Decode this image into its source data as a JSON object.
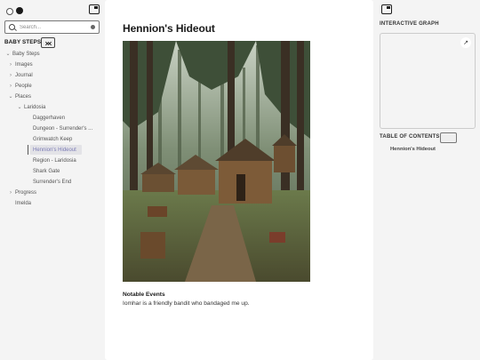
{
  "sidebar": {
    "search_placeholder": "Search...",
    "section_title": "BABY STEPS",
    "tree": [
      {
        "label": "Baby Steps",
        "chevron": "down",
        "level": 0
      },
      {
        "label": "Images",
        "chevron": "right",
        "level": 1
      },
      {
        "label": "Journal",
        "chevron": "right",
        "level": 1
      },
      {
        "label": "People",
        "chevron": "right",
        "level": 1
      },
      {
        "label": "Places",
        "chevron": "down",
        "level": 1
      },
      {
        "label": "Laridosia",
        "chevron": "down",
        "level": 2
      },
      {
        "label": "Daggerhaven",
        "chevron": "",
        "level": 3
      },
      {
        "label": "Dungeon - Surrender's ...",
        "chevron": "",
        "level": 3
      },
      {
        "label": "Grimwatch Keep",
        "chevron": "",
        "level": 3
      },
      {
        "label": "Hennion's Hideout",
        "chevron": "",
        "level": 3,
        "active": true
      },
      {
        "label": "Region - Laridosia",
        "chevron": "",
        "level": 3
      },
      {
        "label": "Shark Gate",
        "chevron": "",
        "level": 3
      },
      {
        "label": "Surrender's End",
        "chevron": "",
        "level": 3
      },
      {
        "label": "Progress",
        "chevron": "right",
        "level": 1
      },
      {
        "label": "Imelda",
        "chevron": "",
        "level": 1
      }
    ]
  },
  "main": {
    "title": "Hennion's Hideout",
    "notable_heading": "Notable Events",
    "notable_text": "Iomhar is a friendly bandit who bandaged me up."
  },
  "right": {
    "graph_title": "INTERACTIVE GRAPH",
    "toc_title": "TABLE OF CONTENTS",
    "toc_items": [
      "Hennion's Hideout"
    ]
  },
  "colors": {
    "sidebar_bg": "#f4f4f4",
    "main_bg": "#ffffff",
    "active_item_bg": "#e3e3e7",
    "active_item_text": "#7b7bb5"
  },
  "icons": {
    "theme_light": "sun-icon",
    "theme_dark": "moon-icon",
    "sidebar_toggle": "panel-icon",
    "search": "search-icon",
    "clear": "clear-icon",
    "collapse": "collapse-all-icon",
    "expand_graph": "arrow-up-right-icon"
  }
}
